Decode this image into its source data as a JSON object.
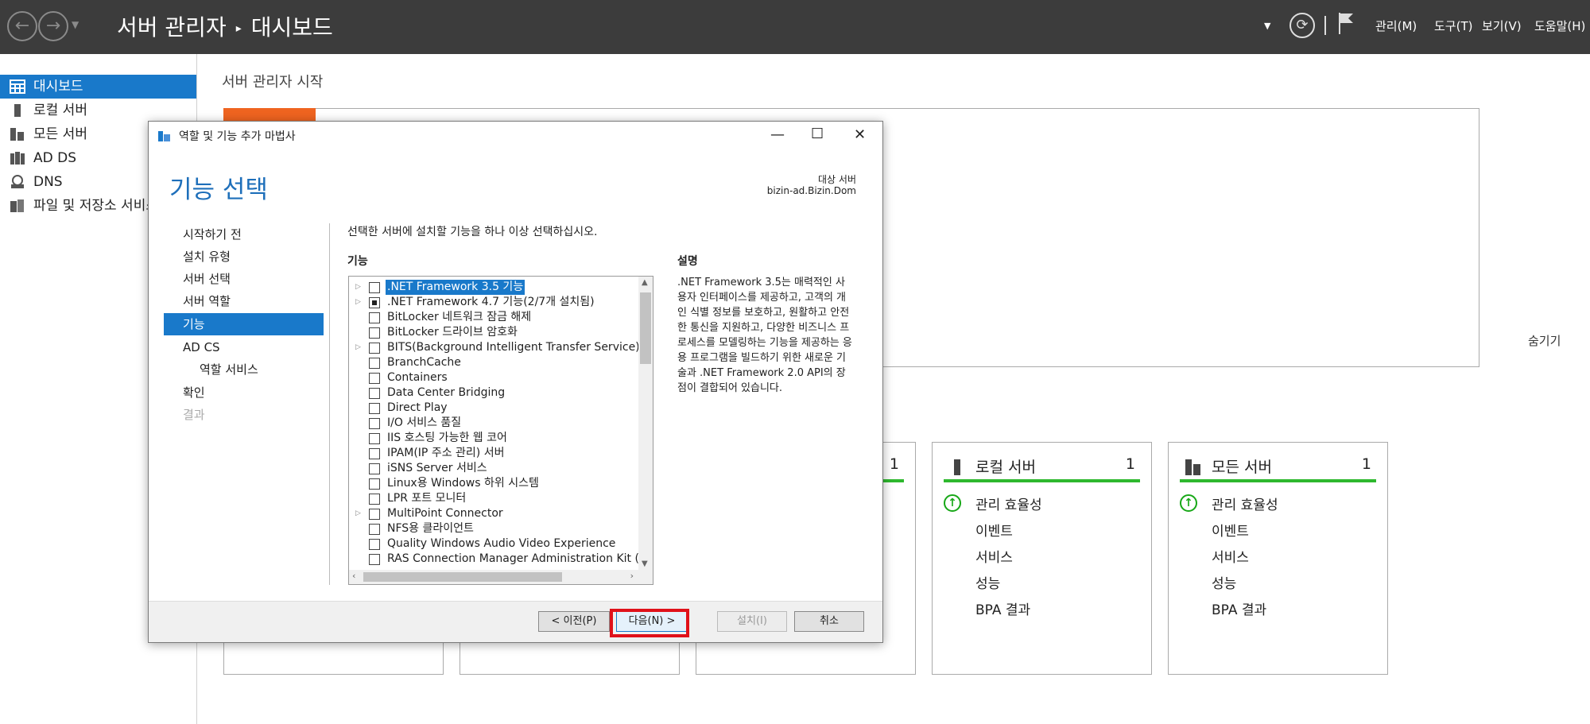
{
  "titlebar": {
    "back_glyph": "←",
    "forward_glyph": "→",
    "breadcrumb_root": "서버 관리자",
    "breadcrumb_current": "대시보드",
    "menus": [
      "관리(M)",
      "도구(T)",
      "보기(V)",
      "도움말(H)"
    ]
  },
  "sidebar": {
    "items": [
      {
        "label": "대시보드",
        "icon": "dashboard-icon"
      },
      {
        "label": "로컬 서버",
        "icon": "local-server-icon"
      },
      {
        "label": "모든 서버",
        "icon": "all-servers-icon"
      },
      {
        "label": "AD DS",
        "icon": "ad-ds-icon"
      },
      {
        "label": "DNS",
        "icon": "dns-icon"
      },
      {
        "label": "파일 및 저장소 서비스",
        "icon": "file-storage-icon"
      }
    ]
  },
  "main": {
    "title": "서버 관리자 시작",
    "hide_link": "숨기기",
    "tiles": [
      {
        "title": "",
        "count": "",
        "rows": []
      },
      {
        "title": "",
        "count": "",
        "rows": []
      },
      {
        "title": "",
        "count": "1",
        "rows": []
      },
      {
        "title": "로컬 서버",
        "count": "1",
        "rows": [
          "관리 효율성",
          "이벤트",
          "서비스",
          "성능",
          "BPA 결과"
        ]
      },
      {
        "title": "모든 서버",
        "count": "1",
        "rows": [
          "관리 효율성",
          "이벤트",
          "서비스",
          "성능",
          "BPA 결과"
        ]
      }
    ]
  },
  "wizard": {
    "title": "역할 및 기능 추가 마법사",
    "header": "기능 선택",
    "target_label": "대상 서버",
    "target_value": "bizin-ad.Bizin.Dom",
    "nav": [
      {
        "label": "시작하기 전",
        "state": "normal"
      },
      {
        "label": "설치 유형",
        "state": "normal"
      },
      {
        "label": "서버 선택",
        "state": "normal"
      },
      {
        "label": "서버 역할",
        "state": "normal"
      },
      {
        "label": "기능",
        "state": "active"
      },
      {
        "label": "AD CS",
        "state": "normal"
      },
      {
        "label": "역할 서비스",
        "state": "sub"
      },
      {
        "label": "확인",
        "state": "normal"
      },
      {
        "label": "결과",
        "state": "disabled"
      }
    ],
    "instruction": "선택한 서버에 설치할 기능을 하나 이상 선택하십시오.",
    "features_label": "기능",
    "description_label": "설명",
    "description": ".NET Framework 3.5는 매력적인 사용자 인터페이스를 제공하고, 고객의 개인 식별 정보를 보호하고, 원활하고 안전한 통신을 지원하고, 다양한 비즈니스 프로세스를 모델링하는 기능을 제공하는 응용 프로그램을 빌드하기 위한 새로운 기술과 .NET Framework 2.0 API의 장점이 결합되어 있습니다.",
    "features": [
      {
        "label": ".NET Framework 3.5 기능",
        "expandable": true,
        "check": "none",
        "selected": true
      },
      {
        "label": ".NET Framework 4.7 기능(2/7개 설치됨)",
        "expandable": true,
        "check": "partial",
        "selected": false
      },
      {
        "label": "BitLocker 네트워크 잠금 해제",
        "expandable": false,
        "check": "none",
        "selected": false
      },
      {
        "label": "BitLocker 드라이브 암호화",
        "expandable": false,
        "check": "none",
        "selected": false
      },
      {
        "label": "BITS(Background Intelligent Transfer Service)",
        "expandable": true,
        "check": "none",
        "selected": false
      },
      {
        "label": "BranchCache",
        "expandable": false,
        "check": "none",
        "selected": false
      },
      {
        "label": "Containers",
        "expandable": false,
        "check": "none",
        "selected": false
      },
      {
        "label": "Data Center Bridging",
        "expandable": false,
        "check": "none",
        "selected": false
      },
      {
        "label": "Direct Play",
        "expandable": false,
        "check": "none",
        "selected": false
      },
      {
        "label": "I/O 서비스 품질",
        "expandable": false,
        "check": "none",
        "selected": false
      },
      {
        "label": "IIS 호스팅 가능한 웹 코어",
        "expandable": false,
        "check": "none",
        "selected": false
      },
      {
        "label": "IPAM(IP 주소 관리) 서버",
        "expandable": false,
        "check": "none",
        "selected": false
      },
      {
        "label": "iSNS Server 서비스",
        "expandable": false,
        "check": "none",
        "selected": false
      },
      {
        "label": "Linux용 Windows 하위 시스템",
        "expandable": false,
        "check": "none",
        "selected": false
      },
      {
        "label": "LPR 포트 모니터",
        "expandable": false,
        "check": "none",
        "selected": false
      },
      {
        "label": "MultiPoint Connector",
        "expandable": true,
        "check": "none",
        "selected": false
      },
      {
        "label": "NFS용 클라이언트",
        "expandable": false,
        "check": "none",
        "selected": false
      },
      {
        "label": "Quality Windows Audio Video Experience",
        "expandable": false,
        "check": "none",
        "selected": false
      },
      {
        "label": "RAS Connection Manager Administration Kit (CM",
        "expandable": false,
        "check": "none",
        "selected": false
      }
    ],
    "buttons": {
      "prev": "< 이전(P)",
      "next": "다음(N) >",
      "install": "설치(I)",
      "cancel": "취소"
    }
  },
  "colors": {
    "accent": "#1979ca",
    "titlebar": "#3c3c3c",
    "status_green": "#2eb82e",
    "highlight_red": "#e0111a",
    "welcome_orange": "#ef6420"
  }
}
